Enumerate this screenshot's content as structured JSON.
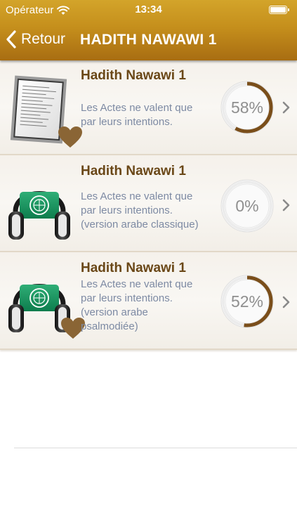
{
  "status_bar": {
    "carrier": "Opérateur",
    "time": "13:34"
  },
  "nav": {
    "back_label": "Retour",
    "title": "HADITH NAWAWI 1"
  },
  "colors": {
    "header_top": "#d3a42a",
    "header_bottom": "#a86d12",
    "title_brown": "#6a4717",
    "desc_blue_gray": "#7d8aa3",
    "progress_arc": "#7a4e1a",
    "heart": "#8a6535"
  },
  "items": [
    {
      "title": "Hadith Nawawi 1",
      "desc_lines": [
        "Les Actes ne valent que",
        "par leurs intentions."
      ],
      "progress": 0.58,
      "progress_label": "58%",
      "icon": "document-icon",
      "favorite": true
    },
    {
      "title": "Hadith Nawawi 1",
      "desc_lines": [
        "Les Actes ne valent que",
        "par leurs intentions.",
        "(version arabe classique)"
      ],
      "progress": 0,
      "progress_label": "0%",
      "icon": "headphones-icon",
      "favorite": false
    },
    {
      "title": "Hadith Nawawi 1",
      "desc_lines": [
        "Les Actes ne valent que",
        "par leurs intentions.",
        "(version arabe",
        "psalmodiée)"
      ],
      "progress": 0.52,
      "progress_label": "52%",
      "icon": "headphones-icon",
      "favorite": true
    }
  ]
}
